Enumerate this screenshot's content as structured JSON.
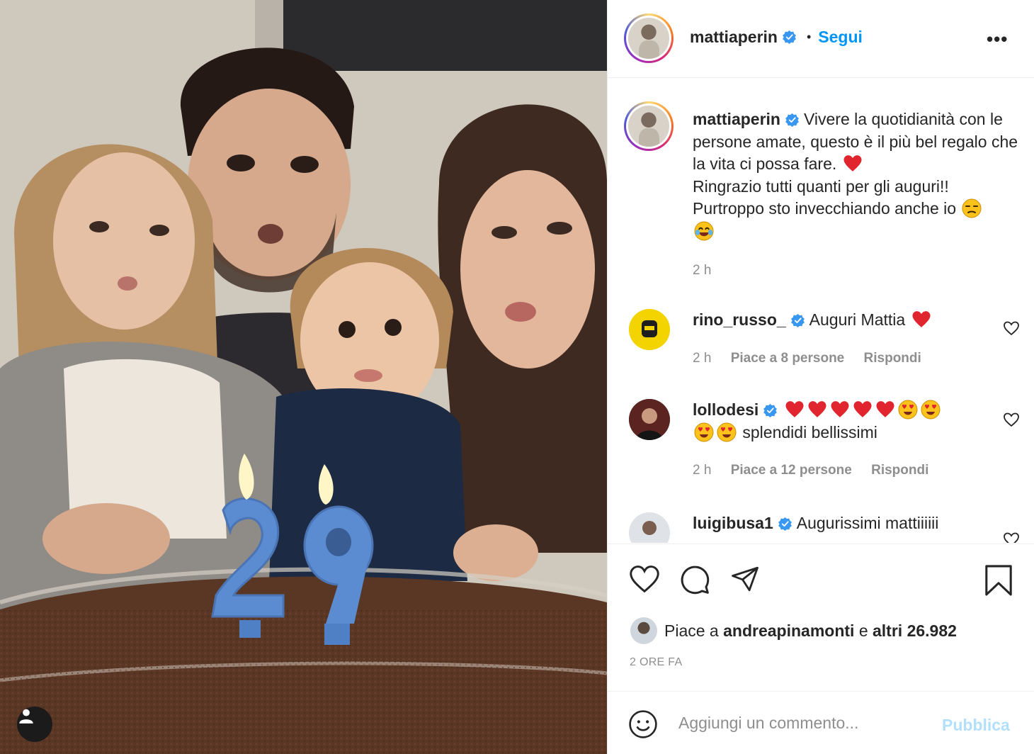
{
  "post": {
    "username": "mattiaperin",
    "follow_label": "Segui",
    "separator": "•",
    "more_label": "•••"
  },
  "caption": {
    "username": "mattiaperin",
    "line1": "Vivere la quotidianità con le persone amate, questo è il più bel regalo che la vita ci possa fare.",
    "line2": "Ringrazio tutti quanti per gli auguri!!",
    "line3": "Purtroppo sto invecchiando anche io",
    "time": "2 h"
  },
  "comments": [
    {
      "username": "rino_russo_",
      "text": "Auguri Mattia",
      "time": "2 h",
      "likes": "Piace a 8 persone",
      "reply": "Rispondi"
    },
    {
      "username": "lollodesi",
      "text": "splendidi bellissimi",
      "time": "2 h",
      "likes": "Piace a 12 persone",
      "reply": "Rispondi"
    },
    {
      "username": "luigibusa1",
      "text": "Augurissimi mattiiiiii"
    }
  ],
  "likes_bar": {
    "prefix": "Piace a",
    "liker": "andreapinamonti",
    "joiner": "e",
    "others": "altri 26.982"
  },
  "timestamp": "2 ORE FA",
  "add_comment": {
    "placeholder": "Aggiungi un commento...",
    "publish_label": "Pubblica"
  },
  "photo": {
    "candle_numbers": "29"
  },
  "colors": {
    "link_blue": "#0095f6",
    "publish_disabled": "#b2dffc",
    "secondary_text": "#8e8e8e",
    "heart_red": "#ed4956",
    "verified_blue": "#3897f0"
  },
  "icons": [
    "heart-icon",
    "comment-icon",
    "share-icon",
    "bookmark-icon",
    "smile-icon",
    "user-tag-icon",
    "verified-icon",
    "more-options-icon"
  ]
}
